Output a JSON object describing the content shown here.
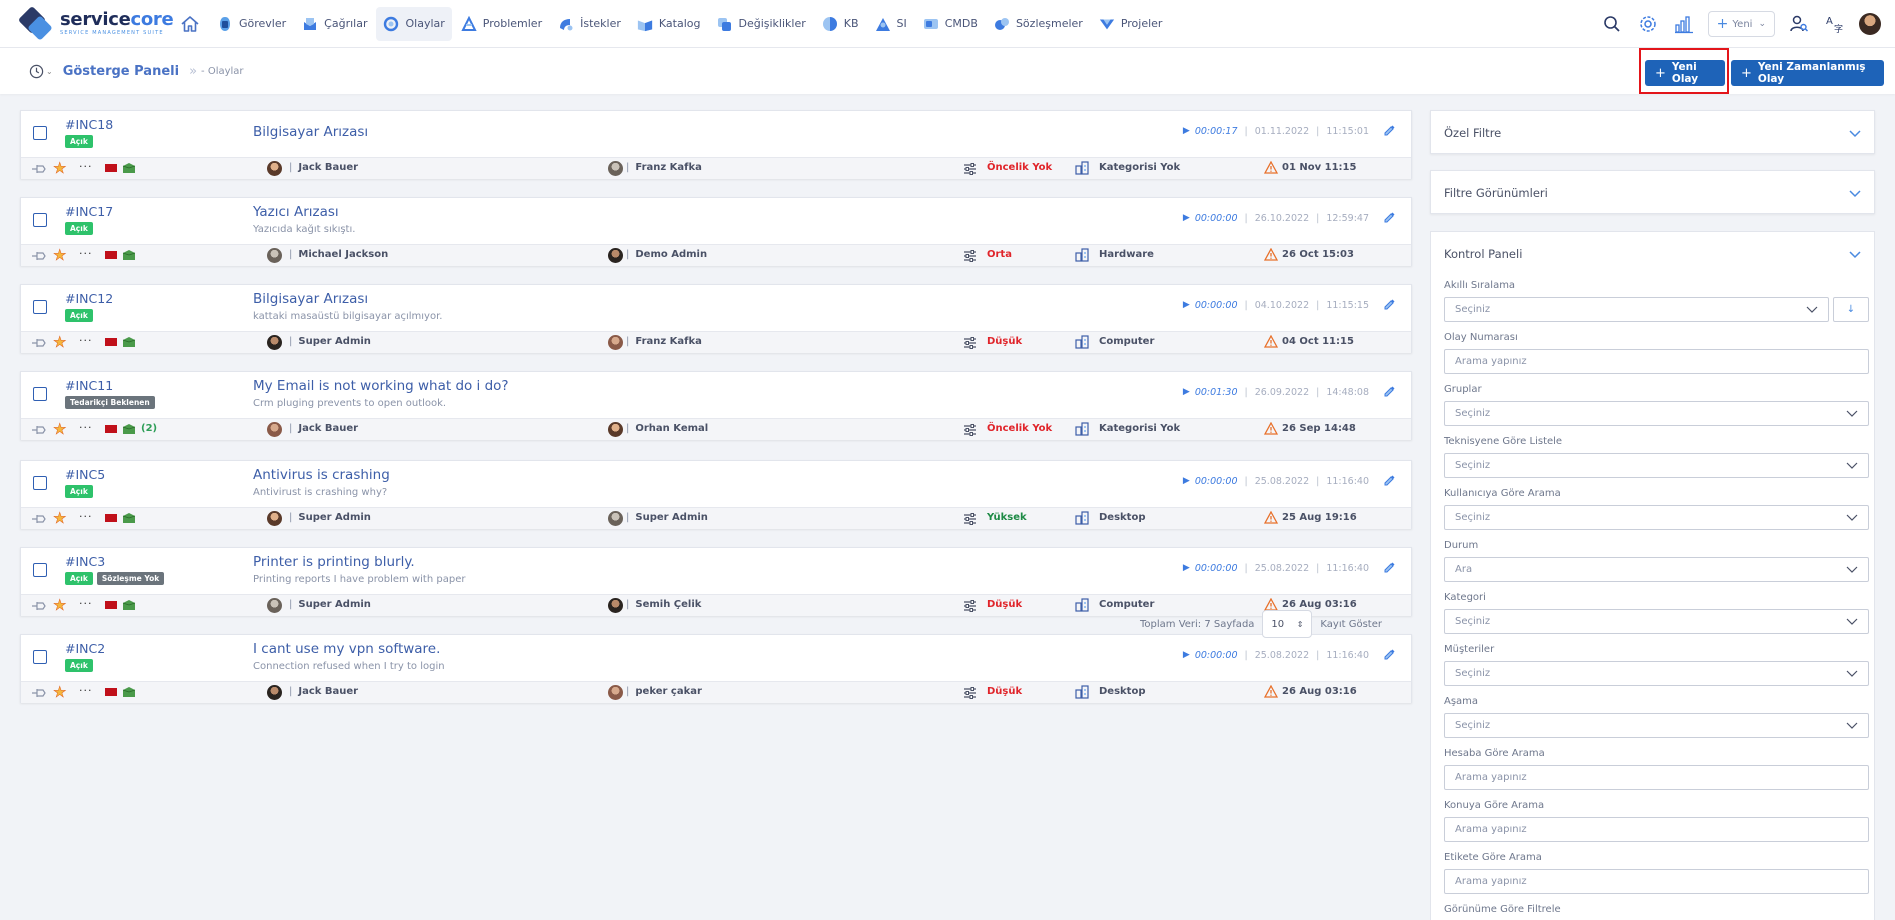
{
  "app": {
    "logo_name_a": "service",
    "logo_name_b": "core",
    "logo_sub": "SERVICE MANAGEMENT SUITE"
  },
  "nav": [
    {
      "label": "Görevler",
      "icon": "tasks-icon",
      "active": false
    },
    {
      "label": "Çağrılar",
      "icon": "calls-icon",
      "active": false
    },
    {
      "label": "Olaylar",
      "icon": "incidents-icon",
      "active": true
    },
    {
      "label": "Problemler",
      "icon": "problems-icon",
      "active": false
    },
    {
      "label": "İstekler",
      "icon": "requests-icon",
      "active": false
    },
    {
      "label": "Katalog",
      "icon": "catalog-icon",
      "active": false
    },
    {
      "label": "Değişiklikler",
      "icon": "changes-icon",
      "active": false
    },
    {
      "label": "KB",
      "icon": "kb-icon",
      "active": false
    },
    {
      "label": "SI",
      "icon": "si-icon",
      "active": false
    },
    {
      "label": "CMDB",
      "icon": "cmdb-icon",
      "active": false
    },
    {
      "label": "Sözleşmeler",
      "icon": "contracts-icon",
      "active": false
    },
    {
      "label": "Projeler",
      "icon": "projects-icon",
      "active": false
    }
  ],
  "topright": {
    "new_label": "Yeni"
  },
  "breadcrumb": {
    "main": "Gösterge Paneli",
    "sub": "- Olaylar"
  },
  "actions": {
    "new_incident": "Yeni Olay",
    "new_scheduled": "Yeni Zamanlanmış Olay"
  },
  "colors": {
    "accent": "#1e63b8",
    "link": "#3d5ea8",
    "badge_open": "#2ec26b",
    "badge_gray": "#6b747c",
    "prio_red": "#e0242a",
    "prio_green": "#1d8a45",
    "highlight": "#e3151a"
  },
  "tickets": [
    {
      "id": "#INC18",
      "badges": [
        {
          "text": "Açık",
          "kind": "green"
        }
      ],
      "title": "Bilgisayar Arızası",
      "desc": "",
      "duration": "00:00:17",
      "date": "01.11.2022",
      "time": "11:15:01",
      "count": "",
      "user1": "Jack Bauer",
      "user2": "Franz Kafka",
      "priority": "Öncelik Yok",
      "priority_color": "#e0242a",
      "category": "Kategorisi Yok",
      "due": "01 Nov 11:15"
    },
    {
      "id": "#INC17",
      "badges": [
        {
          "text": "Açık",
          "kind": "green"
        }
      ],
      "title": "Yazıcı Arızası",
      "desc": "Yazıcıda kağıt sıkıştı.",
      "duration": "00:00:00",
      "date": "26.10.2022",
      "time": "12:59:47",
      "count": "",
      "user1": "Michael Jackson",
      "user2": "Demo Admin",
      "priority": "Orta",
      "priority_color": "#e0242a",
      "category": "Hardware",
      "due": "26 Oct 15:03"
    },
    {
      "id": "#INC12",
      "badges": [
        {
          "text": "Açık",
          "kind": "green"
        }
      ],
      "title": "Bilgisayar Arızası",
      "desc": "kattaki masaüstü bilgisayar açılmıyor.",
      "duration": "00:00:00",
      "date": "04.10.2022",
      "time": "11:15:15",
      "count": "",
      "user1": "Super Admin",
      "user2": "Franz Kafka",
      "priority": "Düşük",
      "priority_color": "#e0242a",
      "category": "Computer",
      "due": "04 Oct 11:15"
    },
    {
      "id": "#INC11",
      "badges": [
        {
          "text": "Tedarikçi Beklenen",
          "kind": "gray"
        }
      ],
      "title": "My Email is not working what do i do?",
      "desc": "Crm pluging prevents to open outlook.",
      "duration": "00:01:30",
      "date": "26.09.2022",
      "time": "14:48:08",
      "count": "(2)",
      "user1": "Jack Bauer",
      "user2": "Orhan Kemal",
      "priority": "Öncelik Yok",
      "priority_color": "#e0242a",
      "category": "Kategorisi Yok",
      "due": "26 Sep 14:48"
    },
    {
      "id": "#INC5",
      "badges": [
        {
          "text": "Açık",
          "kind": "green"
        }
      ],
      "title": "Antivirus is crashing",
      "desc": "Antivirust is crashing why?",
      "duration": "00:00:00",
      "date": "25.08.2022",
      "time": "11:16:40",
      "count": "",
      "user1": "Super Admin",
      "user2": "Super Admin",
      "priority": "Yüksek",
      "priority_color": "#1d8a45",
      "category": "Desktop",
      "due": "25 Aug 19:16"
    },
    {
      "id": "#INC3",
      "badges": [
        {
          "text": "Açık",
          "kind": "green"
        },
        {
          "text": "Sözleşme Yok",
          "kind": "gray"
        }
      ],
      "title": "Printer is printing blurly.",
      "desc": "Printing reports I have problem with paper",
      "duration": "00:00:00",
      "date": "25.08.2022",
      "time": "11:16:40",
      "count": "",
      "user1": "Super Admin",
      "user2": "Semih Çelik",
      "priority": "Düşük",
      "priority_color": "#e0242a",
      "category": "Computer",
      "due": "26 Aug 03:16"
    },
    {
      "id": "#INC2",
      "badges": [
        {
          "text": "Açık",
          "kind": "green"
        }
      ],
      "title": "I cant use my vpn software.",
      "desc": "Connection refused when I try to login",
      "duration": "00:00:00",
      "date": "25.08.2022",
      "time": "11:16:40",
      "count": "",
      "user1": "Jack Bauer",
      "user2": "peker çakar",
      "priority": "Düşük",
      "priority_color": "#e0242a",
      "category": "Desktop",
      "due": "26 Aug 03:16"
    }
  ],
  "pager": {
    "total": "Toplam Veri: 7 Sayfada",
    "page_size": "10",
    "show": "Kayıt Göster"
  },
  "filters": {
    "special": "Özel Filtre",
    "views": "Filtre Görünümleri",
    "control": "Kontrol Paneli",
    "fields": [
      {
        "label": "Akıllı Sıralama",
        "type": "select-sort",
        "value": "Seçiniz"
      },
      {
        "label": "Olay Numarası",
        "type": "input",
        "placeholder": "Arama yapınız"
      },
      {
        "label": "Gruplar",
        "type": "select",
        "value": "Seçiniz"
      },
      {
        "label": "Teknisyene Göre Listele",
        "type": "select",
        "value": "Seçiniz"
      },
      {
        "label": "Kullanıcıya Göre Arama",
        "type": "select",
        "value": "Seçiniz"
      },
      {
        "label": "Durum",
        "type": "select",
        "value": "Ara"
      },
      {
        "label": "Kategori",
        "type": "select",
        "value": "Seçiniz"
      },
      {
        "label": "Müşteriler",
        "type": "select",
        "value": "Seçiniz"
      },
      {
        "label": "Aşama",
        "type": "select",
        "value": "Seçiniz"
      },
      {
        "label": "Hesaba Göre Arama",
        "type": "input",
        "placeholder": "Arama yapınız"
      },
      {
        "label": "Konuya Göre Arama",
        "type": "input",
        "placeholder": "Arama yapınız"
      },
      {
        "label": "Etikete Göre Arama",
        "type": "input",
        "placeholder": "Arama yapınız"
      },
      {
        "label": "Görünüme Göre Filtrele",
        "type": "label-only"
      }
    ]
  }
}
